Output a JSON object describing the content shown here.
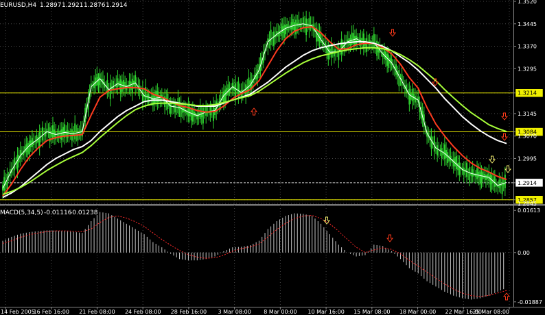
{
  "window": {
    "title": "EURUSD,H4",
    "ohlc": [
      "1.2897",
      "1.2921",
      "1.2876",
      "1.2914"
    ]
  },
  "macd_panel": {
    "title": "MACD(5,34,5)",
    "values": [
      "-0.01116",
      "-0.01238"
    ]
  },
  "colors": {
    "background": "#000000",
    "grid": "#4a4a4a",
    "candles": "#2fd42f",
    "thin_ma": "#ffffff",
    "ma_red": "#ff3b1f",
    "ma_white": "#ffffff",
    "ma_yellowgreen": "#a8ff3a",
    "hline": "#f0f000",
    "current_price_line": "#c8c8c8",
    "macd_hist": "#c8c8c8",
    "macd_signal": "#ff2a2a",
    "arrow_red": "#ff3a1a",
    "arrow_yellow": "#f5f070"
  },
  "chart_data": [
    {
      "type": "line",
      "title": "EURUSD,H4",
      "x": [
        "14 Feb 2005",
        "16 Feb 16:00",
        "21 Feb 08:00",
        "24 Feb 08:00",
        "28 Feb 16:00",
        "3 Mar 08:00",
        "8 Mar 00:00",
        "10 Mar 16:00",
        "15 Mar 08:00",
        "18 Mar 00:00",
        "22 Mar 16:00",
        "25 Mar 08:00"
      ],
      "y_ticks": [
        "1.3520",
        "1.3445",
        "1.3370",
        "1.3295",
        "1.3214",
        "1.3145",
        "1.3084",
        "1.3070",
        "1.2995",
        "1.2914",
        "1.2857",
        "1.2845"
      ],
      "ylim": [
        1.2845,
        1.352
      ],
      "horizontal_lines": [
        {
          "value": 1.3214,
          "label": "1.3214"
        },
        {
          "value": 1.3084,
          "label": "1.3084"
        },
        {
          "value": 1.2857,
          "label": "1.2857"
        }
      ],
      "current_price": {
        "value": 1.2914,
        "label": "1.2914"
      },
      "series": [
        {
          "values": [
            1.2895,
            1.2955,
            1.3005,
            1.3038,
            1.306,
            1.3085,
            1.3075,
            1.3082,
            1.3078,
            1.3085,
            1.3235,
            1.3262,
            1.3225,
            1.3245,
            1.3235,
            1.3248,
            1.3205,
            1.3195,
            1.32,
            1.317,
            1.3165,
            1.315,
            1.3138,
            1.315,
            1.3155,
            1.3205,
            1.3235,
            1.3215,
            1.324,
            1.329,
            1.3385,
            1.341,
            1.343,
            1.344,
            1.3445,
            1.3438,
            1.3392,
            1.335,
            1.3352,
            1.3385,
            1.3395,
            1.338,
            1.3382,
            1.3345,
            1.3315,
            1.3262,
            1.3208,
            1.319,
            1.308,
            1.303,
            1.3012,
            1.2985,
            1.2958,
            1.2945,
            1.2938,
            1.2932,
            1.2905,
            1.2915
          ]
        },
        {
          "values": [
            1.287,
            1.291,
            1.2958,
            1.3,
            1.303,
            1.3055,
            1.3065,
            1.307,
            1.3072,
            1.3075,
            1.314,
            1.32,
            1.3222,
            1.3228,
            1.3232,
            1.3232,
            1.3228,
            1.321,
            1.32,
            1.3185,
            1.3172,
            1.3165,
            1.3155,
            1.315,
            1.3152,
            1.317,
            1.3195,
            1.3212,
            1.3225,
            1.3255,
            1.3305,
            1.3355,
            1.3395,
            1.342,
            1.3432,
            1.3435,
            1.3415,
            1.3385,
            1.336,
            1.3362,
            1.3375,
            1.338,
            1.338,
            1.3365,
            1.3345,
            1.331,
            1.3265,
            1.323,
            1.3165,
            1.311,
            1.307,
            1.3035,
            1.3005,
            1.298,
            1.2962,
            1.295,
            1.2935,
            1.2925
          ]
        },
        {
          "values": [
            1.2865,
            1.288,
            1.29,
            1.2925,
            1.295,
            1.2975,
            1.2995,
            1.301,
            1.3025,
            1.3035,
            1.3055,
            1.3085,
            1.311,
            1.3135,
            1.3155,
            1.317,
            1.3185,
            1.319,
            1.319,
            1.3185,
            1.318,
            1.3175,
            1.317,
            1.317,
            1.317,
            1.318,
            1.319,
            1.32,
            1.321,
            1.323,
            1.325,
            1.3275,
            1.33,
            1.332,
            1.334,
            1.3355,
            1.3365,
            1.3372,
            1.3378,
            1.3382,
            1.3385,
            1.3385,
            1.338,
            1.337,
            1.3355,
            1.3335,
            1.3315,
            1.329,
            1.326,
            1.323,
            1.3195,
            1.3165,
            1.3135,
            1.311,
            1.3088,
            1.307,
            1.3055,
            1.3045
          ]
        },
        {
          "values": [
            1.2875,
            1.2885,
            1.2898,
            1.2915,
            1.2935,
            1.2955,
            1.2972,
            1.2988,
            1.3002,
            1.3015,
            1.3038,
            1.3065,
            1.309,
            1.3115,
            1.3138,
            1.3158,
            1.317,
            1.3178,
            1.318,
            1.318,
            1.3178,
            1.3175,
            1.3172,
            1.3172,
            1.3175,
            1.3182,
            1.319,
            1.3198,
            1.3205,
            1.322,
            1.324,
            1.326,
            1.328,
            1.3298,
            1.3315,
            1.3328,
            1.3338,
            1.3345,
            1.3352,
            1.3358,
            1.3362,
            1.3365,
            1.3365,
            1.3362,
            1.3355,
            1.3342,
            1.3325,
            1.3305,
            1.328,
            1.3255,
            1.3225,
            1.3198,
            1.3172,
            1.3148,
            1.3128,
            1.3108,
            1.3095,
            1.3085
          ]
        }
      ]
    },
    {
      "type": "bar",
      "title": "MACD(5,34,5)",
      "y_ticks": [
        "0.01613",
        "0.00",
        "-0.01887"
      ],
      "ylim": [
        -0.0205,
        0.0175
      ],
      "series": [
        {
          "values": [
            0.0045,
            0.006,
            0.0072,
            0.0078,
            0.0082,
            0.0085,
            0.0084,
            0.0082,
            0.0079,
            0.0075,
            0.012,
            0.0155,
            0.015,
            0.013,
            0.011,
            0.009,
            0.007,
            0.004,
            0.002,
            -0.0005,
            -0.0025,
            -0.003,
            -0.003,
            -0.0025,
            -0.0015,
            0.0005,
            0.002,
            0.0022,
            0.0028,
            0.0045,
            0.009,
            0.012,
            0.014,
            0.015,
            0.0148,
            0.014,
            0.011,
            0.007,
            0.003,
            0.0,
            -0.0015,
            -0.001,
            0.003,
            0.0025,
            0.0005,
            -0.0025,
            -0.006,
            -0.008,
            -0.011,
            -0.013,
            -0.015,
            -0.0165,
            -0.0175,
            -0.018,
            -0.0175,
            -0.0165,
            -0.015,
            -0.0135
          ]
        },
        {
          "values": [
            0.0035,
            0.0045,
            0.0058,
            0.0068,
            0.0075,
            0.008,
            0.0083,
            0.0083,
            0.0082,
            0.008,
            0.009,
            0.0115,
            0.0135,
            0.014,
            0.0132,
            0.0118,
            0.01,
            0.0075,
            0.005,
            0.0028,
            0.0008,
            -0.0008,
            -0.0018,
            -0.0022,
            -0.002,
            -0.001,
            0.0005,
            0.0015,
            0.0022,
            0.0032,
            0.006,
            0.0088,
            0.0112,
            0.013,
            0.014,
            0.0142,
            0.013,
            0.011,
            0.0082,
            0.005,
            0.002,
            0.0,
            0.001,
            0.0018,
            0.0012,
            -0.0005,
            -0.003,
            -0.0052,
            -0.0075,
            -0.0098,
            -0.012,
            -0.014,
            -0.0155,
            -0.0165,
            -0.0168,
            -0.0164,
            -0.0155,
            -0.0145
          ]
        }
      ]
    }
  ]
}
